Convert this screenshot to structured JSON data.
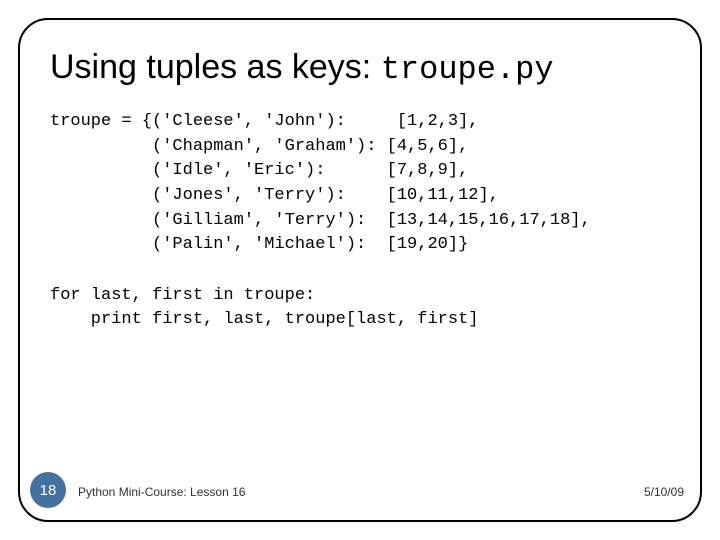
{
  "title": {
    "main": "Using tuples as keys: ",
    "mono": "troupe.py"
  },
  "code1": "troupe = {('Cleese', 'John'):     [1,2,3],\n          ('Chapman', 'Graham'): [4,5,6],\n          ('Idle', 'Eric'):      [7,8,9],\n          ('Jones', 'Terry'):    [10,11,12],\n          ('Gilliam', 'Terry'):  [13,14,15,16,17,18],\n          ('Palin', 'Michael'):  [19,20]}",
  "code2": "for last, first in troupe:\n    print first, last, troupe[last, first]",
  "footer": {
    "page": "18",
    "course": "Python Mini-Course: Lesson 16",
    "date": "5/10/09"
  }
}
